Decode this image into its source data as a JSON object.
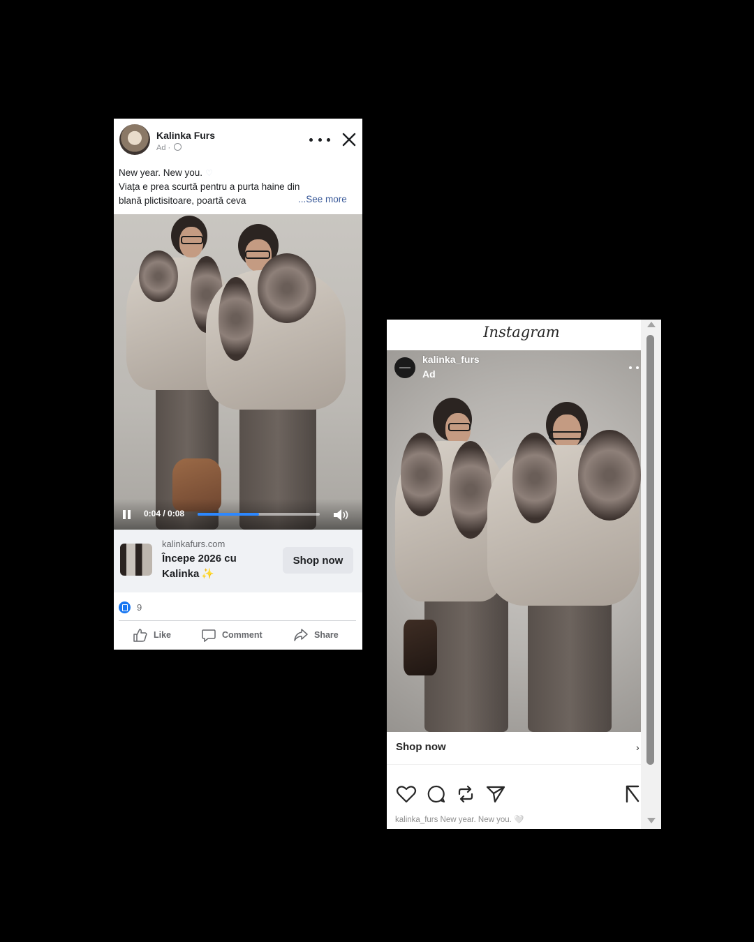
{
  "facebook": {
    "page_name": "Kalinka Furs",
    "sponsored_label": "Ad ·",
    "caption_lines": [
      "New year. New you.",
      "Viața e prea scurtă pentru a purta haine din",
      "blană plictisitoare, poartă ceva"
    ],
    "see_more": "...See more",
    "video": {
      "time": "0:04 / 0:08",
      "progress": 0.5
    },
    "cta": {
      "domain": "kalinkafurs.com",
      "headline": "Începe 2026 cu Kalinka",
      "headline_emoji": "✨",
      "button": "Shop now"
    },
    "reaction_count": "9",
    "actions": {
      "like": "Like",
      "comment": "Comment",
      "share": "Share"
    },
    "colors": {
      "accent": "#1877f2",
      "progress": "#2d88ff",
      "link": "#385898"
    }
  },
  "instagram": {
    "app_title": "Instagram",
    "username": "kalinka_furs",
    "sponsored_label": "Ad",
    "shop_label": "Shop now",
    "chevron": "›",
    "caption": "kalinka_furs New year. New you. 🤍",
    "icons": [
      "heart-icon",
      "comment-icon",
      "repost-icon",
      "send-icon",
      "bookmark-icon"
    ]
  }
}
